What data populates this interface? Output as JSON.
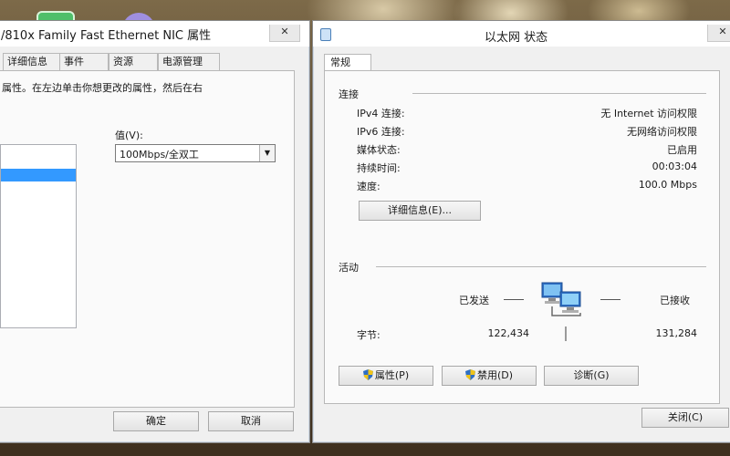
{
  "left_window": {
    "title": "/810x Family Fast Ethernet NIC 属性",
    "close_label": "✕",
    "tabs": [
      {
        "label": "详细信息"
      },
      {
        "label": "事件"
      },
      {
        "label": "资源"
      },
      {
        "label": "电源管理"
      }
    ],
    "description": "属性。在左边单击你想更改的属性，然后在右",
    "value_label": "值(V):",
    "value_selected": "100Mbps/全双工",
    "ok_label": "确定",
    "cancel_label": "取消"
  },
  "right_window": {
    "title": "以太网 状态",
    "close_label": "✕",
    "tab_general": "常规",
    "connection": {
      "section_label": "连接",
      "rows": [
        {
          "label": "IPv4 连接:",
          "value": "无 Internet 访问权限"
        },
        {
          "label": "IPv6 连接:",
          "value": "无网络访问权限"
        },
        {
          "label": "媒体状态:",
          "value": "已启用"
        },
        {
          "label": "持续时间:",
          "value": "00:03:04"
        },
        {
          "label": "速度:",
          "value": "100.0 Mbps"
        }
      ],
      "details_button": "详细信息(E)..."
    },
    "activity": {
      "section_label": "活动",
      "sent_label": "已发送",
      "received_label": "已接收",
      "bytes_label": "字节:",
      "bytes_sent": "122,434",
      "bytes_received": "131,284"
    },
    "buttons": {
      "properties": "属性(P)",
      "disable": "禁用(D)",
      "diagnose": "诊断(G)",
      "close": "关闭(C)"
    }
  },
  "icons": {
    "network": "network-computers-icon",
    "shield": "uac-shield-icon",
    "adapter": "network-adapter-icon"
  },
  "colors": {
    "selection": "#3399ff",
    "window_bg": "#f0f0f0"
  }
}
